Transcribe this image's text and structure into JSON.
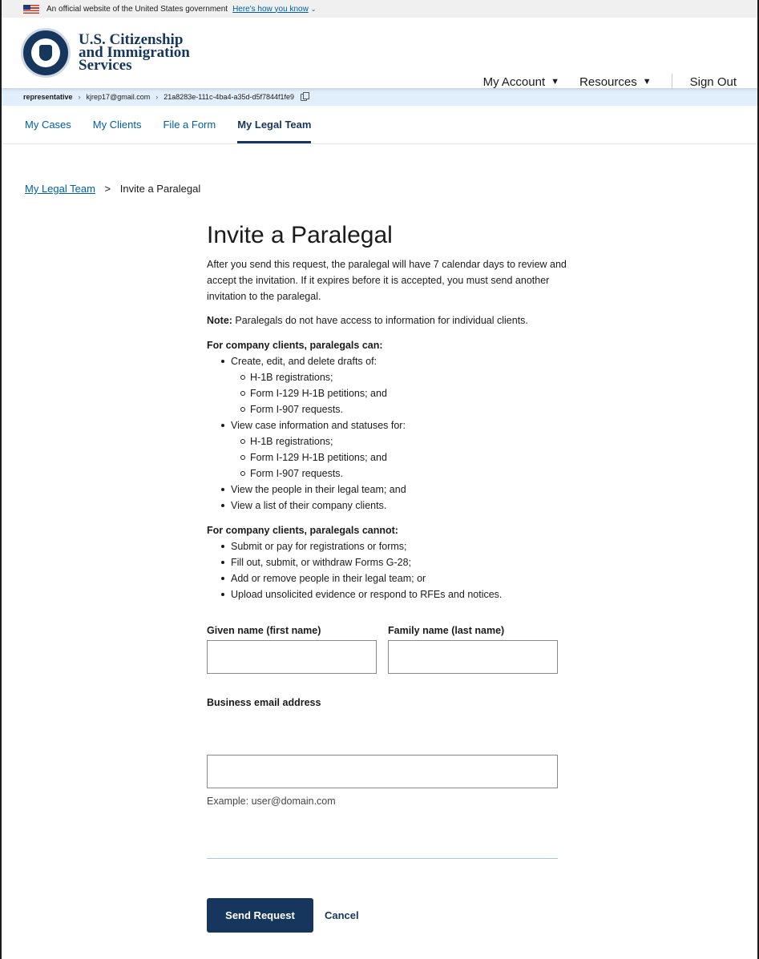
{
  "gov_banner": {
    "text": "An official website of the United States government",
    "link": "Here's how you know"
  },
  "header": {
    "agency_line1": "U.S. Citizenship",
    "agency_line2": "and Immigration",
    "agency_line3": "Services",
    "nav": {
      "my_account": "My Account",
      "resources": "Resources",
      "sign_out": "Sign Out"
    }
  },
  "identity_bar": {
    "role": "representative",
    "email": "kjrep17@gmail.com",
    "account_id": "21a8283e-111c-4ba4-a35d-d5f7844f1fe9"
  },
  "tabs": [
    {
      "label": "My Cases"
    },
    {
      "label": "My Clients"
    },
    {
      "label": "File a Form"
    },
    {
      "label": "My Legal Team",
      "active": true
    }
  ],
  "breadcrumb": {
    "parent": "My Legal Team",
    "current": "Invite a Paralegal"
  },
  "main": {
    "title": "Invite a Paralegal",
    "intro": "After you send this request, the paralegal will have 7 calendar days to review and accept the invitation. If it expires before it is accepted, you must send another invitation to the paralegal.",
    "note_label": "Note:",
    "note_text": " Paralegals do not have access to information for individual clients.",
    "can_heading": "For company clients, paralegals can:",
    "can": {
      "item1": "Create, edit, and delete drafts of:",
      "item1_sub": [
        "H-1B registrations;",
        "Form I-129 H-1B petitions; and",
        "Form I-907 requests."
      ],
      "item2": "View case information and statuses for:",
      "item2_sub": [
        "H-1B registrations;",
        "Form I-129 H-1B petitions; and",
        "Form I-907 requests."
      ],
      "item3": "View the people in their legal team; and",
      "item4": "View a list of their company clients."
    },
    "cannot_heading": "For company clients, paralegals cannot:",
    "cannot": [
      "Submit or pay for registrations or forms;",
      "Fill out, submit, or withdraw Forms G-28;",
      "Add or remove people in their legal team; or",
      "Upload unsolicited evidence or respond to RFEs and notices."
    ]
  },
  "form": {
    "given_name_label": "Given name (first name)",
    "given_name_value": "",
    "family_name_label": "Family name (last name)",
    "family_name_value": "",
    "email_label": "Business email address",
    "email_value": "",
    "email_hint": "Example: user@domain.com",
    "send_button": "Send Request",
    "cancel_button": "Cancel"
  },
  "colors": {
    "brand_navy": "#17365d",
    "link_blue": "#005ea2",
    "identity_bar_bg": "#e1eefb"
  }
}
